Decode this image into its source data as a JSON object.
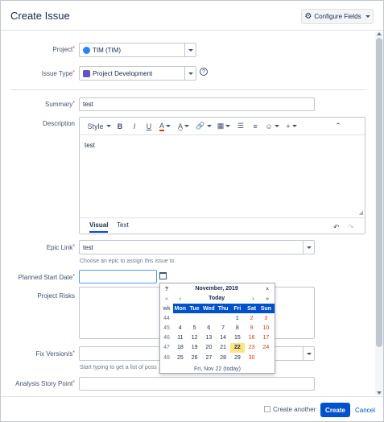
{
  "dialog": {
    "title": "Create Issue",
    "configure_fields_label": "Configure Fields"
  },
  "fields": {
    "project": {
      "label": "Project",
      "value": "TIM (TIM)"
    },
    "issue_type": {
      "label": "Issue Type",
      "value": "Project Development"
    },
    "summary": {
      "label": "Summary",
      "value": "test"
    },
    "description": {
      "label": "Description",
      "value": "test",
      "toolbar": {
        "style": "Style",
        "bold": "B",
        "italic": "I",
        "underline": "U",
        "color": "A"
      },
      "tabs": {
        "visual": "Visual",
        "text": "Text"
      }
    },
    "epic_link": {
      "label": "Epic Link",
      "value": "test",
      "hint": "Choose an epic to assign this issue to."
    },
    "planned_start_date": {
      "label": "Planned Start Date",
      "value": ""
    },
    "project_risks": {
      "label": "Project Risks",
      "value": ""
    },
    "fix_versions": {
      "label": "Fix Version/s",
      "value": "",
      "hint": "Start typing to get a list of poss"
    },
    "analysis_story_point": {
      "label": "Analysis Story Point",
      "value": ""
    }
  },
  "calendar": {
    "help": "?",
    "month_year": "November, 2019",
    "close": "×",
    "nav": {
      "prev_year": "«",
      "prev_month": "‹",
      "today": "Today",
      "next_month": "›",
      "next_year": "»"
    },
    "week_label": "wk",
    "day_headers": [
      "Mon",
      "Tue",
      "Wed",
      "Thu",
      "Fri",
      "Sat",
      "Sun"
    ],
    "weeks": [
      {
        "wk": "44",
        "days": [
          "",
          "",
          "",
          "",
          "1",
          "2",
          "3"
        ]
      },
      {
        "wk": "45",
        "days": [
          "4",
          "5",
          "6",
          "7",
          "8",
          "9",
          "10"
        ]
      },
      {
        "wk": "46",
        "days": [
          "11",
          "12",
          "13",
          "14",
          "15",
          "16",
          "17"
        ]
      },
      {
        "wk": "47",
        "days": [
          "18",
          "19",
          "20",
          "21",
          "22",
          "23",
          "24"
        ]
      },
      {
        "wk": "48",
        "days": [
          "25",
          "26",
          "27",
          "28",
          "29",
          "30",
          ""
        ]
      }
    ],
    "highlight": "22",
    "footer": "Fri, Nov 22 (today)"
  },
  "footer": {
    "create_another": "Create another",
    "create": "Create",
    "cancel": "Cancel"
  },
  "colors": {
    "primary": "#0052cc",
    "required": "#de350b",
    "today_highlight": "#ffe380"
  }
}
